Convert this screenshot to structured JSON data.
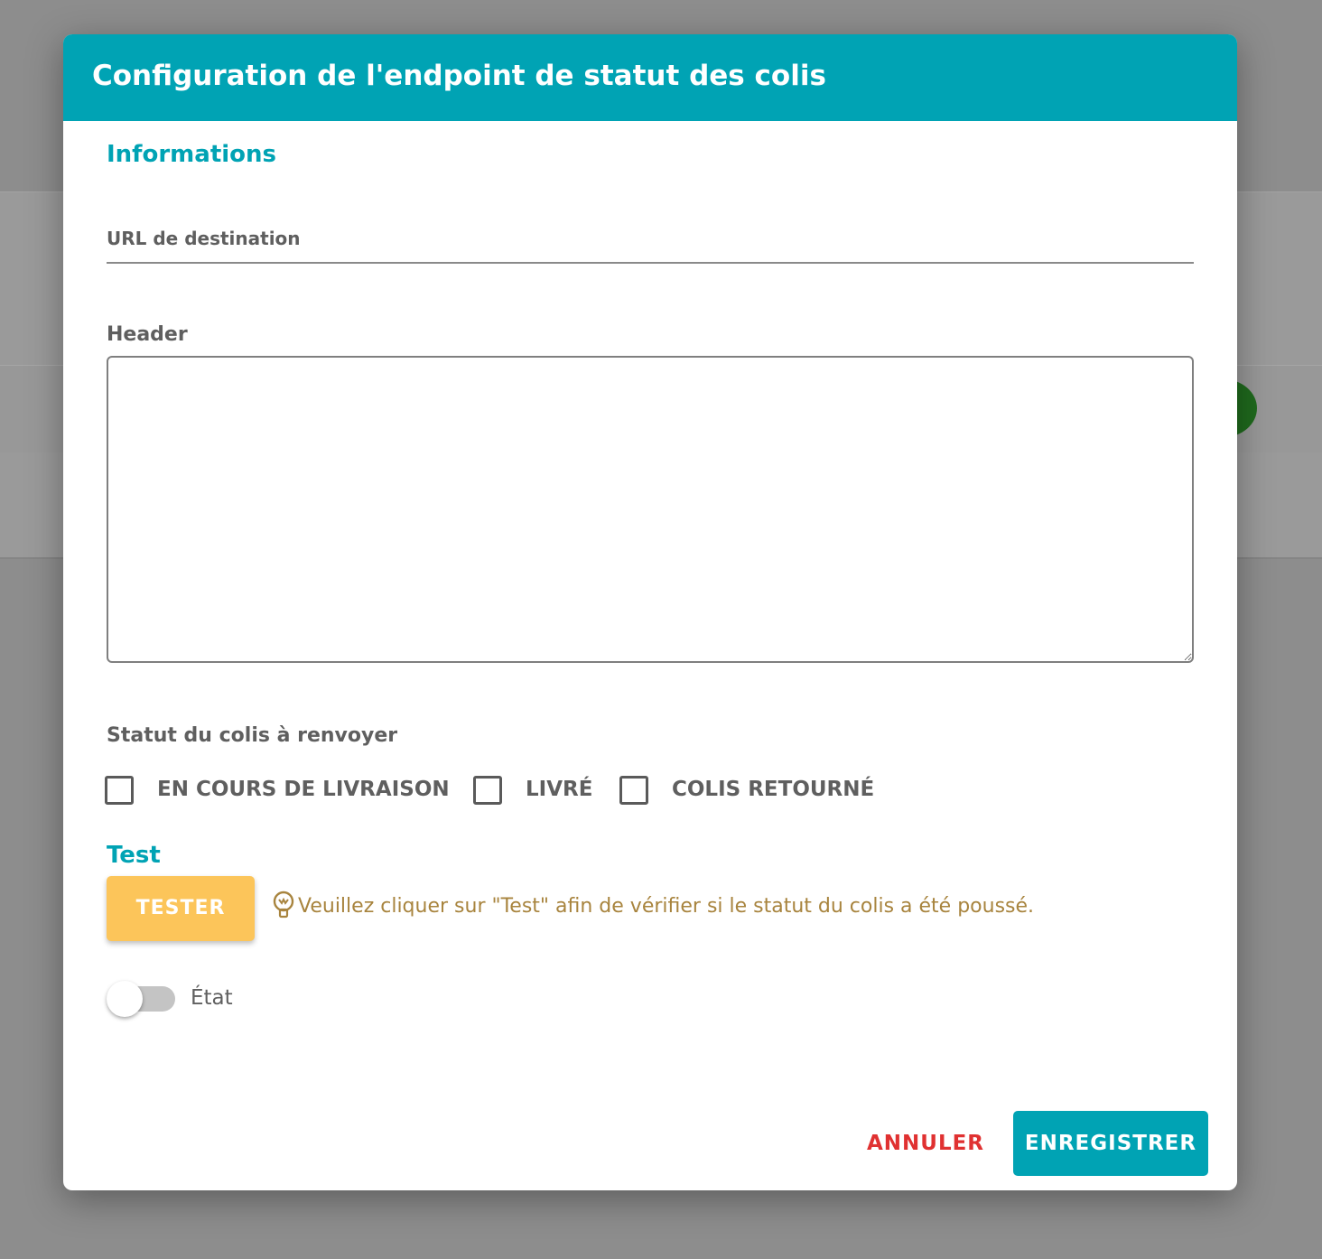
{
  "dialog": {
    "title": "Configuration de l'endpoint de statut des colis"
  },
  "informations": {
    "section_title": "Informations",
    "url_placeholder": "URL de destination",
    "url_value": "",
    "header_label": "Header",
    "header_value": ""
  },
  "status": {
    "label": "Statut du colis à renvoyer",
    "options": [
      {
        "label": "EN COURS DE LIVRAISON",
        "checked": false
      },
      {
        "label": "LIVRÉ",
        "checked": false
      },
      {
        "label": "COLIS RETOURNÉ",
        "checked": false
      }
    ]
  },
  "test": {
    "section_title": "Test",
    "button_label": "TESTER",
    "hint_icon": "lightbulb-icon",
    "hint_text": "Veuillez cliquer sur \"Test\" afin de vérifier si le statut du colis a été poussé."
  },
  "state_toggle": {
    "label": "État",
    "on": false
  },
  "footer": {
    "cancel_label": "ANNULER",
    "save_label": "ENREGISTRER"
  },
  "colors": {
    "accent": "#00a3b4",
    "warning_button": "#fcc55a",
    "cancel": "#e03131",
    "hint": "#a8843e"
  }
}
